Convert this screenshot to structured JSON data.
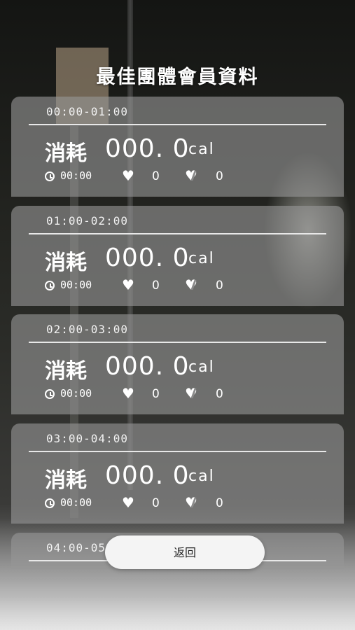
{
  "header": {
    "title": "最佳團體會員資料"
  },
  "cards": [
    {
      "time": "00:00-01:00",
      "consume_label": "消耗",
      "calories": "000. 0",
      "unit": "cal",
      "duration": "00:00",
      "hearts": "0",
      "broken_hearts": "0"
    },
    {
      "time": "01:00-02:00",
      "consume_label": "消耗",
      "calories": "000. 0",
      "unit": "cal",
      "duration": "00:00",
      "hearts": "0",
      "broken_hearts": "0"
    },
    {
      "time": "02:00-03:00",
      "consume_label": "消耗",
      "calories": "000. 0",
      "unit": "cal",
      "duration": "00:00",
      "hearts": "0",
      "broken_hearts": "0"
    },
    {
      "time": "03:00-04:00",
      "consume_label": "消耗",
      "calories": "000. 0",
      "unit": "cal",
      "duration": "00:00",
      "hearts": "0",
      "broken_hearts": "0"
    },
    {
      "time": "04:00-05"
    }
  ],
  "footer": {
    "back_label": "返回"
  },
  "icons": {
    "clock": "clock-icon",
    "heart": "heart-icon",
    "broken_heart": "broken-heart-icon"
  }
}
